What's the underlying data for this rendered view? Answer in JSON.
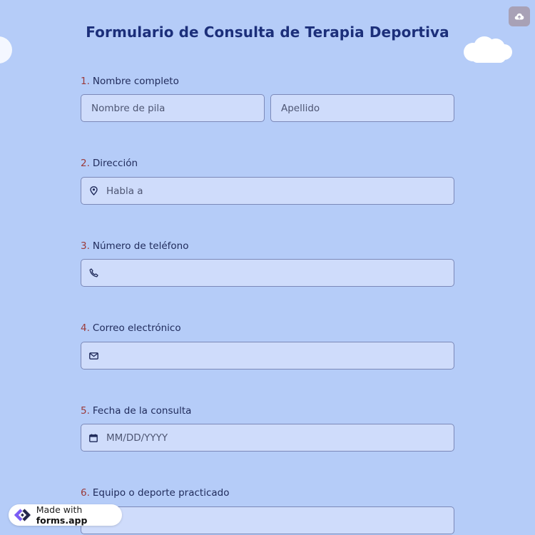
{
  "form": {
    "title": "Formulario de Consulta de Terapia Deportiva"
  },
  "questions": [
    {
      "number": "1.",
      "label": "Nombre completo",
      "first_name_placeholder": "Nombre de pila",
      "last_name_placeholder": "Apellido"
    },
    {
      "number": "2.",
      "label": "Dirección",
      "placeholder": "Habla a",
      "icon": "location-pin-icon"
    },
    {
      "number": "3.",
      "label": "Número de teléfono",
      "placeholder": "",
      "icon": "phone-icon"
    },
    {
      "number": "4.",
      "label": "Correo electrónico",
      "placeholder": "",
      "icon": "envelope-icon"
    },
    {
      "number": "5.",
      "label": "Fecha de la consulta",
      "placeholder": "MM/DD/YYYY",
      "icon": "calendar-icon"
    },
    {
      "number": "6.",
      "label": "Equipo o deporte practicado",
      "placeholder": ""
    }
  ],
  "badge": {
    "prefix": "Made with",
    "brand": "forms.app",
    "icon": "forms-app-logo-icon"
  },
  "toolbar": {
    "save_icon": "cloud-upload-icon"
  },
  "colors": {
    "background": "#b5ccf8",
    "field_background": "#cfdcfb",
    "field_border": "#7c89b8",
    "title": "#1c2f7a",
    "question_number": "#9a3a3a"
  }
}
